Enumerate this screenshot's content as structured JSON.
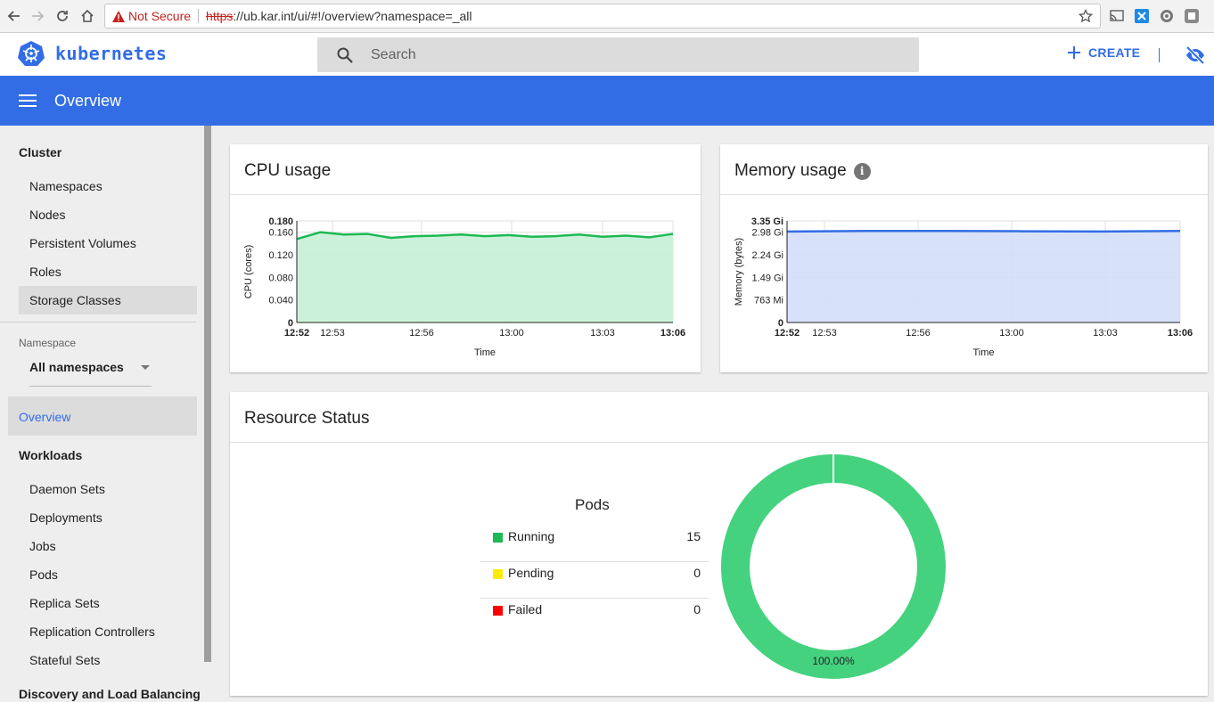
{
  "browser": {
    "security_label": "Not Secure",
    "url_scheme": "https",
    "url_rest": "://ub.kar.int/ui/#!/overview?namespace=_all"
  },
  "header": {
    "logo_text": "kubernetes",
    "search_placeholder": "Search",
    "create_label": "CREATE"
  },
  "toolbar": {
    "title": "Overview"
  },
  "sidebar": {
    "cluster_heading": "Cluster",
    "cluster_items": [
      {
        "label": "Namespaces"
      },
      {
        "label": "Nodes"
      },
      {
        "label": "Persistent Volumes"
      },
      {
        "label": "Roles"
      },
      {
        "label": "Storage Classes"
      }
    ],
    "namespace_label": "Namespace",
    "namespace_value": "All namespaces",
    "overview_label": "Overview",
    "workloads_heading": "Workloads",
    "workload_items": [
      {
        "label": "Daemon Sets"
      },
      {
        "label": "Deployments"
      },
      {
        "label": "Jobs"
      },
      {
        "label": "Pods"
      },
      {
        "label": "Replica Sets"
      },
      {
        "label": "Replication Controllers"
      },
      {
        "label": "Stateful Sets"
      }
    ],
    "discovery_heading": "Discovery and Load Balancing"
  },
  "cpu_card": {
    "title": "CPU usage"
  },
  "memory_card": {
    "title": "Memory usage",
    "info_glyph": "i"
  },
  "resource_card": {
    "title": "Resource Status"
  },
  "pods": {
    "title": "Pods",
    "rows": [
      {
        "name": "Running",
        "count": "15",
        "color": "#1db954"
      },
      {
        "name": "Pending",
        "count": "0",
        "color": "#ffeb00"
      },
      {
        "name": "Failed",
        "count": "0",
        "color": "#ff0000"
      }
    ],
    "donut_label": "100.00%",
    "donut_color": "#44d27e"
  },
  "chart_data": [
    {
      "type": "area",
      "title": "CPU usage",
      "xlabel": "Time",
      "ylabel": "CPU (cores)",
      "ylim": [
        0,
        0.18
      ],
      "yticks": [
        "0",
        "0.040",
        "0.080",
        "0.120",
        "0.160",
        "0.180"
      ],
      "xticks": [
        "12:52",
        "12:53",
        "12:56",
        "13:00",
        "13:03",
        "13:06"
      ],
      "x": [
        "12:52",
        "12:53",
        "12:53:30",
        "12:54",
        "12:55",
        "12:55:30",
        "12:56",
        "12:57",
        "12:58",
        "12:59",
        "13:00",
        "13:01",
        "13:02",
        "13:03",
        "13:04",
        "13:05",
        "13:06"
      ],
      "values": [
        0.148,
        0.16,
        0.156,
        0.157,
        0.15,
        0.153,
        0.154,
        0.156,
        0.153,
        0.155,
        0.152,
        0.153,
        0.156,
        0.152,
        0.154,
        0.151,
        0.157
      ],
      "line_color": "#1db954",
      "fill_color": "#c6f0d6",
      "grid": true
    },
    {
      "type": "area",
      "title": "Memory usage",
      "xlabel": "Time",
      "ylabel": "Memory (bytes)",
      "ylim": [
        0,
        3.35
      ],
      "yticks": [
        "0",
        "763 Mi",
        "1.49 Gi",
        "2.24 Gi",
        "2.98 Gi",
        "3.35 Gi"
      ],
      "xticks": [
        "12:52",
        "12:53",
        "12:56",
        "13:00",
        "13:03",
        "13:06"
      ],
      "x": [
        "12:52",
        "12:53",
        "12:56",
        "13:00",
        "13:03",
        "13:06"
      ],
      "values": [
        3.0,
        3.02,
        3.02,
        3.01,
        3.0,
        3.02
      ],
      "line_color": "#326de6",
      "fill_color": "#d3defa",
      "grid": true
    }
  ]
}
